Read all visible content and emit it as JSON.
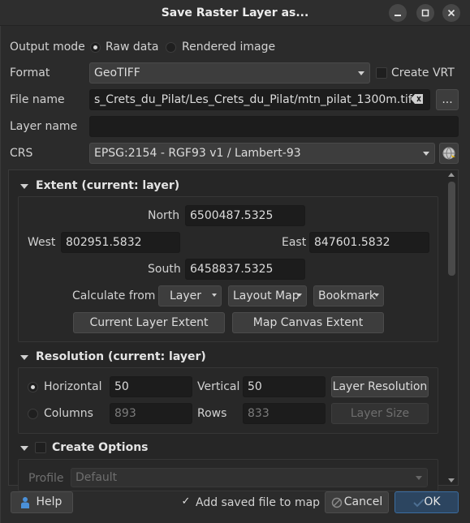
{
  "window": {
    "title": "Save Raster Layer as..."
  },
  "output_mode": {
    "label": "Output mode",
    "options": [
      "Raw data",
      "Rendered image"
    ],
    "selected": "Raw data"
  },
  "format": {
    "label": "Format",
    "value": "GeoTIFF",
    "create_vrt_label": "Create VRT"
  },
  "file_name": {
    "label": "File name",
    "value": "s_Crets_du_Pilat/Les_Crets_du_Pilat/mtn_pilat_1300m.tif",
    "browse_label": "..."
  },
  "layer_name": {
    "label": "Layer name",
    "value": ""
  },
  "crs": {
    "label": "CRS",
    "value": "EPSG:2154 - RGF93 v1 / Lambert-93"
  },
  "extent": {
    "title": "Extent (current: layer)",
    "north_label": "North",
    "north": "6500487.5325",
    "west_label": "West",
    "west": "802951.5832",
    "east_label": "East",
    "east": "847601.5832",
    "south_label": "South",
    "south": "6458837.5325",
    "calc_label": "Calculate from",
    "calc_buttons": [
      "Layer",
      "Layout Map",
      "Bookmark"
    ],
    "current_layer_extent": "Current Layer Extent",
    "map_canvas_extent": "Map Canvas Extent"
  },
  "resolution": {
    "title": "Resolution (current: layer)",
    "horizontal_label": "Horizontal",
    "horizontal": "50",
    "vertical_label": "Vertical",
    "vertical": "50",
    "layer_resolution": "Layer Resolution",
    "columns_label": "Columns",
    "columns": "893",
    "rows_label": "Rows",
    "rows": "833",
    "layer_size": "Layer Size"
  },
  "create_options": {
    "title": "Create Options",
    "profile_label": "Profile",
    "profile": "Default"
  },
  "footer": {
    "help": "Help",
    "add_to_map": "Add saved file to map",
    "cancel": "Cancel",
    "ok": "OK"
  },
  "colors": {
    "background": "#2b2b2b",
    "field": "#1c1c1c",
    "button": "#3d3d3d",
    "accent": "#3b6da0"
  }
}
